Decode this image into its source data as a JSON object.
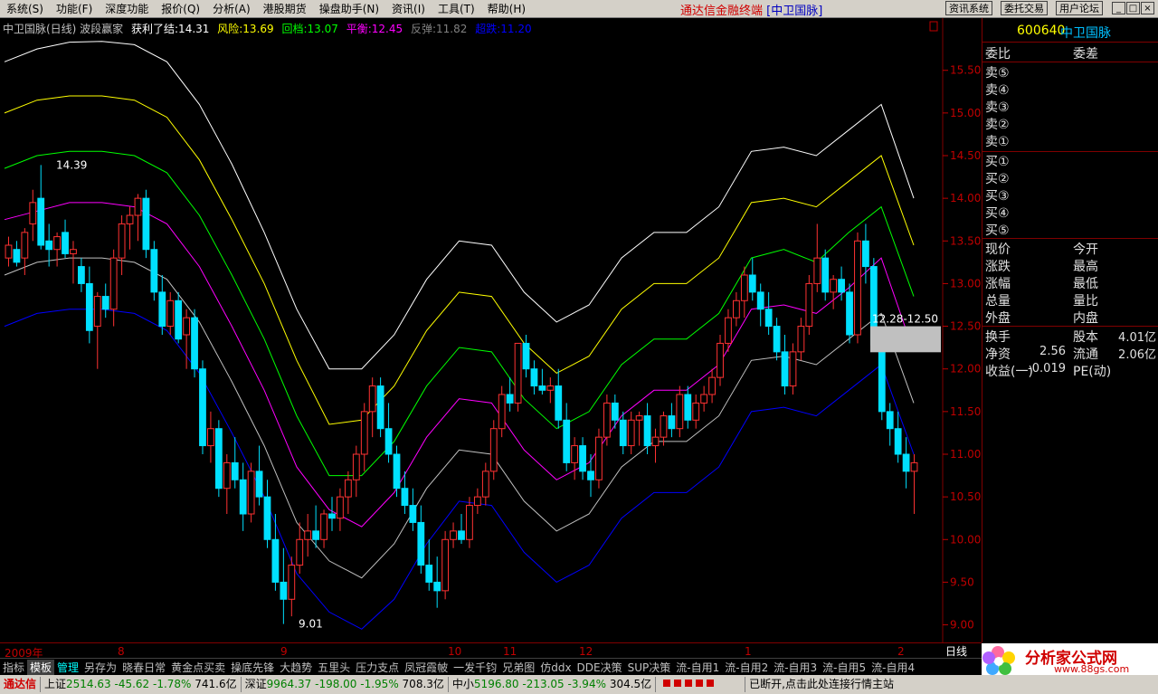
{
  "menu": [
    "系统(S)",
    "功能(F)",
    "深度功能",
    "报价(Q)",
    "分析(A)",
    "港股期货",
    "操盘助手(N)",
    "资讯(I)",
    "工具(T)",
    "帮助(H)"
  ],
  "app_title": "通达信金融终端",
  "app_title_stock": "[中卫国脉]",
  "top_buttons": [
    "资讯系统",
    "委托交易",
    "用户论坛"
  ],
  "window_buttons": [
    "_",
    "□",
    "×"
  ],
  "legend": {
    "title": "中卫国脉(日线) 波段赢家",
    "items": [
      {
        "text": "获利了结:14.31",
        "color": "#ffffff"
      },
      {
        "text": "风险:13.69",
        "color": "#ffff00"
      },
      {
        "text": "回档:13.07",
        "color": "#00ff00"
      },
      {
        "text": "平衡:12.45",
        "color": "#ff00ff"
      },
      {
        "text": "反弹:11.82",
        "color": "#808080"
      },
      {
        "text": "超跌:11.20",
        "color": "#0000ff"
      }
    ]
  },
  "price_axis": [
    "15.50",
    "15.00",
    "14.50",
    "14.00",
    "13.50",
    "13.00",
    "12.50",
    "12.00",
    "11.50",
    "11.00",
    "10.50",
    "10.00",
    "9.50",
    "9.00"
  ],
  "annotations": {
    "high": "14.39",
    "low": "9.01",
    "range": "12.28-12.50"
  },
  "time_axis": [
    "2009年",
    "8",
    "9",
    "10",
    "11",
    "12",
    "1",
    "2"
  ],
  "period": "日线",
  "tabs": [
    "指标",
    "模板",
    "管理",
    "另存为",
    "晓春日常",
    "黄金点买卖",
    "操底先锋",
    "大趋势",
    "五里头",
    "压力支点",
    "凤冠霞帔",
    "一发千钧",
    "兄弟图",
    "仿ddx",
    "DDE决策",
    "SUP决策",
    "流-自用1",
    "流-自用2",
    "流-自用3",
    "流-自用5",
    "流-自用4"
  ],
  "quote": {
    "code": "600640",
    "name": "中卫国脉",
    "header_left": "委比",
    "header_right": "委差",
    "sells": [
      "卖⑤",
      "卖④",
      "卖③",
      "卖②",
      "卖①"
    ],
    "buys": [
      "买①",
      "买②",
      "买③",
      "买④",
      "买⑤"
    ],
    "rows": [
      [
        "现价",
        "今开"
      ],
      [
        "涨跌",
        "最高"
      ],
      [
        "涨幅",
        "最低"
      ],
      [
        "总量",
        "量比"
      ],
      [
        "外盘",
        "内盘"
      ]
    ],
    "stats": [
      {
        "l1": "换手",
        "v1": "",
        "l2": "股本",
        "v2": "4.01亿"
      },
      {
        "l1": "净资",
        "v1": "2.56",
        "l2": "流通",
        "v2": "2.06亿"
      },
      {
        "l1": "收益(一)",
        "v1": "-0.019",
        "l2": "PE(动)",
        "v2": ""
      }
    ]
  },
  "status": {
    "brand": "通达信",
    "sh_label": "上证",
    "sh_price": "2514.63",
    "sh_chg": "-45.62",
    "sh_pct": "-1.78%",
    "sh_vol": "741.6亿",
    "sz_label": "深证",
    "sz_price": "9964.37",
    "sz_chg": "-198.00",
    "sz_pct": "-1.95%",
    "sz_vol": "708.3亿",
    "zx_label": "中小",
    "zx_price": "5196.80",
    "zx_chg": "-213.05",
    "zx_pct": "-3.94%",
    "zx_vol": "304.5亿",
    "msg": "已断开,点击此处连接行情主站"
  },
  "logo": {
    "title": "分析家公式网",
    "url": "www.88gs.com"
  },
  "chart_data": {
    "type": "candlestick",
    "ylim": [
      8.9,
      15.9
    ],
    "bands": [
      {
        "name": "获利了结",
        "color": "#ffffff",
        "values": [
          15.6,
          15.75,
          15.83,
          15.84,
          15.8,
          15.6,
          15.1,
          14.4,
          13.6,
          12.7,
          12.0,
          12.0,
          12.4,
          13.05,
          13.5,
          13.45,
          12.9,
          12.55,
          12.75,
          13.3,
          13.6,
          13.6,
          13.9,
          14.55,
          14.6,
          14.5,
          14.8,
          15.1,
          14.0
        ]
      },
      {
        "name": "风险",
        "color": "#ffff00",
        "values": [
          15.0,
          15.15,
          15.2,
          15.2,
          15.15,
          14.95,
          14.45,
          13.75,
          13.0,
          12.1,
          11.35,
          11.4,
          11.8,
          12.45,
          12.9,
          12.85,
          12.3,
          11.95,
          12.15,
          12.7,
          13.0,
          13.0,
          13.3,
          13.95,
          14.0,
          13.9,
          14.2,
          14.5,
          13.45
        ]
      },
      {
        "name": "回档",
        "color": "#00ff00",
        "values": [
          14.35,
          14.5,
          14.55,
          14.55,
          14.5,
          14.3,
          13.8,
          13.1,
          12.35,
          11.45,
          10.75,
          10.75,
          11.15,
          11.8,
          12.25,
          12.2,
          11.65,
          11.3,
          11.5,
          12.05,
          12.35,
          12.35,
          12.65,
          13.3,
          13.4,
          13.25,
          13.6,
          13.9,
          12.85
        ]
      },
      {
        "name": "平衡",
        "color": "#ff00ff",
        "values": [
          13.75,
          13.85,
          13.95,
          13.95,
          13.9,
          13.7,
          13.2,
          12.5,
          11.75,
          10.85,
          10.35,
          10.15,
          10.55,
          11.2,
          11.65,
          11.6,
          11.05,
          10.7,
          10.9,
          11.45,
          11.75,
          11.75,
          12.05,
          12.7,
          12.75,
          12.65,
          12.95,
          13.3,
          12.2
        ]
      },
      {
        "name": "反弹",
        "color": "#c0c0c0",
        "values": [
          13.1,
          13.25,
          13.3,
          13.3,
          13.25,
          13.05,
          12.55,
          11.85,
          11.1,
          10.2,
          9.75,
          9.55,
          9.95,
          10.6,
          11.05,
          11.0,
          10.45,
          10.1,
          10.3,
          10.85,
          11.15,
          11.15,
          11.45,
          12.1,
          12.15,
          12.05,
          12.35,
          12.65,
          11.6
        ]
      },
      {
        "name": "超跌",
        "color": "#0000ff",
        "values": [
          12.5,
          12.65,
          12.7,
          12.7,
          12.65,
          12.45,
          11.95,
          11.25,
          10.5,
          9.6,
          9.15,
          8.95,
          9.3,
          9.95,
          10.45,
          10.4,
          9.85,
          9.5,
          9.7,
          10.25,
          10.55,
          10.55,
          10.85,
          11.5,
          11.55,
          11.45,
          11.75,
          12.05,
          11.0
        ]
      }
    ],
    "candles": [
      [
        13.3,
        13.55,
        13.2,
        13.45
      ],
      [
        13.4,
        13.5,
        13.2,
        13.25
      ],
      [
        13.3,
        13.65,
        13.1,
        13.6
      ],
      [
        13.7,
        14.1,
        13.5,
        13.95
      ],
      [
        14.0,
        14.39,
        13.4,
        13.45
      ],
      [
        13.5,
        13.7,
        13.2,
        13.4
      ],
      [
        13.4,
        13.6,
        13.2,
        13.55
      ],
      [
        13.6,
        13.75,
        13.3,
        13.35
      ],
      [
        13.35,
        13.5,
        13.0,
        13.4
      ],
      [
        13.2,
        13.3,
        12.9,
        13.0
      ],
      [
        13.0,
        13.2,
        12.3,
        12.45
      ],
      [
        12.5,
        12.9,
        12.0,
        12.85
      ],
      [
        12.85,
        13.0,
        12.6,
        12.7
      ],
      [
        12.7,
        13.4,
        12.5,
        13.3
      ],
      [
        13.3,
        13.8,
        13.1,
        13.7
      ],
      [
        13.7,
        13.9,
        13.4,
        13.8
      ],
      [
        13.8,
        14.05,
        13.5,
        14.0
      ],
      [
        14.0,
        14.1,
        13.3,
        13.4
      ],
      [
        13.4,
        13.5,
        12.8,
        12.9
      ],
      [
        12.9,
        13.1,
        12.4,
        12.5
      ],
      [
        12.5,
        12.9,
        12.4,
        12.8
      ],
      [
        12.8,
        12.9,
        12.3,
        12.35
      ],
      [
        12.4,
        12.7,
        12.0,
        12.6
      ],
      [
        12.6,
        12.7,
        11.9,
        12.0
      ],
      [
        12.0,
        12.1,
        11.0,
        11.1
      ],
      [
        11.1,
        11.5,
        10.9,
        11.3
      ],
      [
        11.3,
        11.4,
        10.5,
        10.6
      ],
      [
        10.6,
        11.0,
        10.3,
        10.9
      ],
      [
        10.9,
        11.2,
        10.6,
        10.7
      ],
      [
        10.7,
        10.9,
        10.1,
        10.3
      ],
      [
        10.3,
        10.9,
        10.2,
        10.8
      ],
      [
        10.8,
        11.1,
        10.4,
        10.5
      ],
      [
        10.5,
        10.7,
        9.9,
        10.0
      ],
      [
        10.0,
        10.3,
        9.4,
        9.5
      ],
      [
        9.5,
        9.9,
        9.01,
        9.3
      ],
      [
        9.3,
        9.8,
        9.1,
        9.7
      ],
      [
        9.7,
        10.2,
        9.6,
        10.0
      ],
      [
        10.0,
        10.3,
        9.8,
        10.1
      ],
      [
        10.1,
        10.4,
        9.9,
        10.0
      ],
      [
        10.0,
        10.35,
        9.9,
        10.3
      ],
      [
        10.3,
        10.5,
        10.1,
        10.25
      ],
      [
        10.25,
        10.6,
        10.1,
        10.5
      ],
      [
        10.5,
        10.8,
        10.3,
        10.7
      ],
      [
        10.7,
        11.1,
        10.5,
        11.0
      ],
      [
        11.0,
        11.6,
        10.8,
        11.5
      ],
      [
        11.5,
        11.9,
        11.2,
        11.8
      ],
      [
        11.8,
        11.9,
        11.2,
        11.3
      ],
      [
        11.3,
        11.6,
        10.9,
        11.0
      ],
      [
        11.0,
        11.1,
        10.5,
        10.6
      ],
      [
        10.6,
        10.8,
        10.3,
        10.4
      ],
      [
        10.4,
        10.6,
        10.1,
        10.2
      ],
      [
        10.2,
        10.4,
        9.6,
        9.7
      ],
      [
        9.7,
        10.0,
        9.4,
        9.5
      ],
      [
        9.5,
        9.8,
        9.2,
        9.4
      ],
      [
        9.4,
        10.1,
        9.3,
        10.0
      ],
      [
        10.0,
        10.2,
        9.9,
        10.1
      ],
      [
        10.1,
        10.3,
        9.95,
        10.0
      ],
      [
        10.0,
        10.5,
        9.9,
        10.4
      ],
      [
        10.4,
        10.6,
        10.3,
        10.5
      ],
      [
        10.5,
        10.9,
        10.4,
        10.8
      ],
      [
        10.8,
        11.4,
        10.7,
        11.3
      ],
      [
        11.3,
        11.8,
        11.2,
        11.7
      ],
      [
        11.7,
        11.9,
        11.5,
        11.6
      ],
      [
        11.6,
        12.3,
        11.5,
        12.3
      ],
      [
        12.3,
        12.4,
        11.9,
        12.0
      ],
      [
        12.0,
        12.1,
        11.7,
        11.8
      ],
      [
        11.8,
        12.0,
        11.7,
        11.75
      ],
      [
        11.75,
        11.9,
        11.6,
        11.8
      ],
      [
        11.8,
        12.0,
        11.3,
        11.4
      ],
      [
        11.4,
        11.6,
        10.8,
        10.9
      ],
      [
        10.9,
        11.2,
        10.7,
        11.1
      ],
      [
        11.1,
        11.2,
        10.7,
        10.8
      ],
      [
        10.8,
        11.0,
        10.5,
        10.7
      ],
      [
        10.7,
        11.3,
        10.6,
        11.2
      ],
      [
        11.2,
        11.7,
        11.1,
        11.6
      ],
      [
        11.6,
        11.7,
        11.3,
        11.4
      ],
      [
        11.4,
        11.5,
        11.0,
        11.1
      ],
      [
        11.1,
        11.5,
        11.0,
        11.4
      ],
      [
        11.4,
        11.5,
        11.1,
        11.45
      ],
      [
        11.45,
        11.6,
        11.0,
        11.1
      ],
      [
        11.1,
        11.3,
        10.9,
        11.2
      ],
      [
        11.2,
        11.5,
        11.1,
        11.45
      ],
      [
        11.45,
        11.6,
        11.2,
        11.3
      ],
      [
        11.3,
        11.8,
        11.2,
        11.7
      ],
      [
        11.7,
        11.8,
        11.3,
        11.4
      ],
      [
        11.4,
        11.7,
        11.3,
        11.6
      ],
      [
        11.6,
        11.8,
        11.5,
        11.7
      ],
      [
        11.7,
        12.0,
        11.6,
        11.9
      ],
      [
        11.9,
        12.4,
        11.8,
        12.3
      ],
      [
        12.3,
        12.7,
        12.2,
        12.6
      ],
      [
        12.6,
        12.9,
        12.5,
        12.8
      ],
      [
        12.8,
        13.2,
        12.6,
        13.1
      ],
      [
        13.1,
        13.3,
        12.8,
        12.9
      ],
      [
        12.9,
        13.0,
        12.5,
        12.7
      ],
      [
        12.7,
        12.9,
        12.4,
        12.5
      ],
      [
        12.5,
        12.6,
        12.1,
        12.2
      ],
      [
        12.2,
        12.4,
        11.7,
        11.8
      ],
      [
        11.8,
        12.3,
        11.7,
        12.2
      ],
      [
        12.2,
        12.6,
        12.1,
        12.5
      ],
      [
        12.5,
        13.1,
        12.4,
        13.0
      ],
      [
        13.0,
        13.7,
        12.9,
        13.3
      ],
      [
        13.3,
        13.4,
        12.8,
        12.9
      ],
      [
        12.9,
        13.1,
        12.7,
        13.05
      ],
      [
        13.05,
        13.2,
        12.8,
        12.9
      ],
      [
        12.9,
        13.0,
        12.3,
        12.4
      ],
      [
        12.4,
        13.6,
        12.3,
        13.5
      ],
      [
        13.5,
        13.7,
        13.0,
        13.2
      ],
      [
        13.2,
        13.3,
        12.2,
        12.28
      ],
      [
        12.28,
        12.3,
        11.4,
        11.5
      ],
      [
        11.5,
        11.6,
        11.1,
        11.3
      ],
      [
        11.3,
        11.5,
        10.9,
        11.0
      ],
      [
        11.0,
        11.2,
        10.6,
        10.8
      ],
      [
        10.8,
        11.0,
        10.3,
        10.9
      ]
    ]
  }
}
